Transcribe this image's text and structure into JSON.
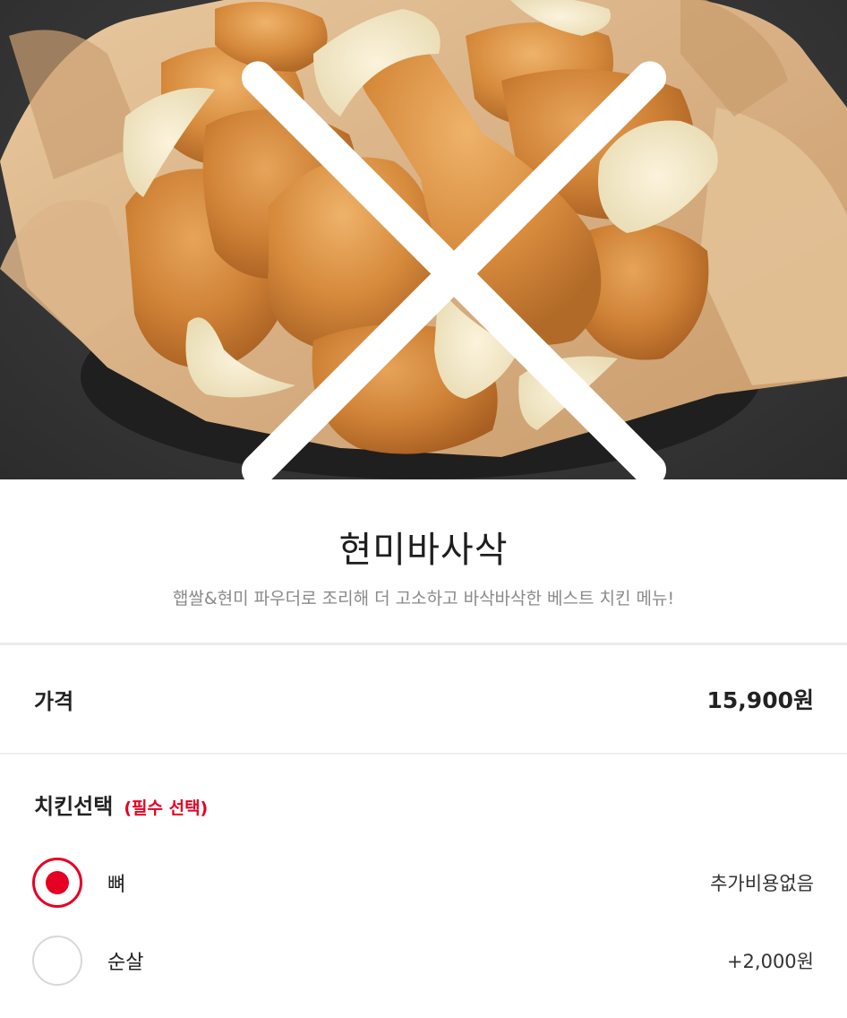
{
  "header": {
    "close_icon": "close-icon",
    "share_icon": "share-icon"
  },
  "product": {
    "name": "현미바사삭",
    "description": "햅쌀&현미 파우더로 조리해 더 고소하고 바삭바삭한 베스트 치킨 메뉴!"
  },
  "price": {
    "label": "가격",
    "value": "15,900원"
  },
  "chicken_select": {
    "title": "치킨선택",
    "required_label": "(필수 선택)",
    "options": [
      {
        "label": "뼈",
        "price": "추가비용없음",
        "selected": true
      },
      {
        "label": "순살",
        "price": "+2,000원",
        "selected": false
      }
    ]
  },
  "colors": {
    "accent": "#e60023",
    "text": "#222222",
    "muted": "#8a8a8a",
    "divider": "#ececec"
  }
}
